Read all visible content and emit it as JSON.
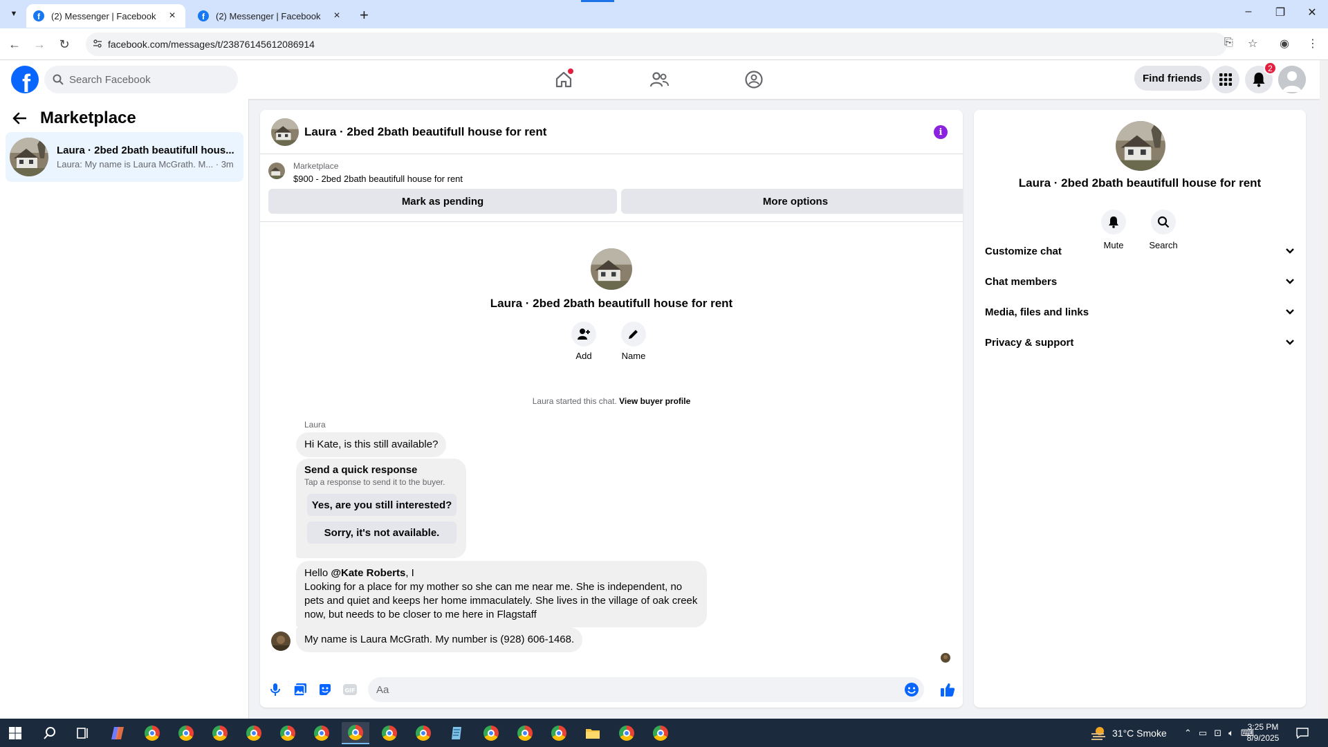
{
  "browser": {
    "tabs": [
      {
        "title": "(2) Messenger | Facebook",
        "active": true
      },
      {
        "title": "(2) Messenger | Facebook",
        "active": false
      }
    ],
    "url": "facebook.com/messages/t/23876145612086914"
  },
  "fb": {
    "search_placeholder": "Search Facebook",
    "find_friends": "Find friends",
    "notification_count": "2"
  },
  "sidebar": {
    "title": "Marketplace",
    "conversation": {
      "name": "Laura · 2bed 2bath beautifull hous...",
      "preview": "Laura: My name is Laura McGrath. M... · 3m"
    }
  },
  "chat": {
    "title": "Laura · 2bed 2bath beautifull house for rent",
    "listing_category": "Marketplace",
    "listing_title": "$900 - 2bed 2bath beautifull house for rent",
    "mark_pending": "Mark as pending",
    "more_options": "More options",
    "intro_name": "Laura · 2bed 2bath beautifull house for rent",
    "add_label": "Add",
    "name_label": "Name",
    "system_msg": "Laura started this chat. ",
    "view_buyer": "View buyer profile",
    "sender": "Laura",
    "msg1": "Hi Kate, is this still available?",
    "quick_title": "Send a quick response",
    "quick_sub": "Tap a response to send it to the buyer.",
    "quick_opt1": "Yes, are you still interested?",
    "quick_opt2": "Sorry, it's not available.",
    "msg2_prefix": "Hello ",
    "msg2_mention": "@Kate Roberts",
    "msg2_after": ", I",
    "msg2_body": "Looking for a place for my mother so she can me near me.  She is independent, no pets and quiet and keeps her home immaculately.  She lives in the village of oak creek now, but needs to be closer to me here in Flagstaff",
    "msg3": "My name is Laura McGrath. My number is (928) 606-1468.",
    "composer_placeholder": "Aa"
  },
  "right_panel": {
    "name": "Laura · 2bed 2bath beautifull house for rent",
    "mute": "Mute",
    "search": "Search",
    "sections": [
      "Customize chat",
      "Chat members",
      "Media, files and links",
      "Privacy & support"
    ]
  },
  "taskbar": {
    "weather": "31°C  Smoke",
    "time": "3:25 PM",
    "date": "8/9/2025"
  },
  "colors": {
    "fb_blue": "#0866ff",
    "selected_bg": "#ebf5ff",
    "info_purple": "#8a22e0",
    "badge_red": "#e41e3f"
  }
}
